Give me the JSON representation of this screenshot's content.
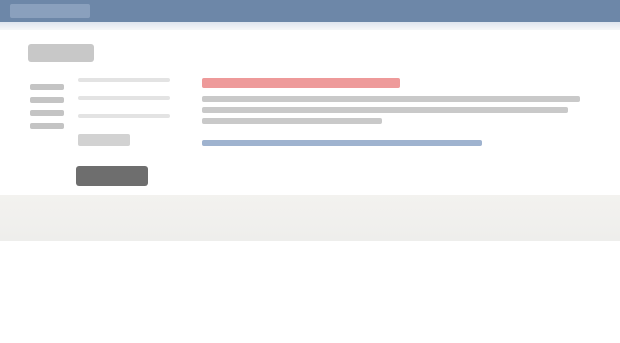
{
  "colors": {
    "header_bar": "#6d87a8",
    "error_text": "#ee9a9a",
    "link_text": "#9fb3cf",
    "footer_bg": "#f3f2ef"
  },
  "icons": []
}
